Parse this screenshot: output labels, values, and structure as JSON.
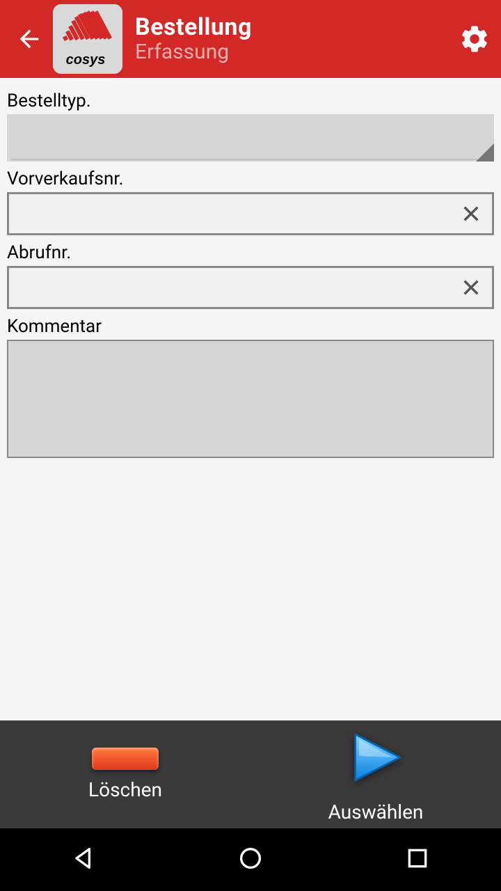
{
  "header": {
    "title": "Bestellung",
    "subtitle": "Erfassung",
    "logo_brand": "cosys"
  },
  "form": {
    "type_label": "Bestelltyp.",
    "type_value": "",
    "presale_label": "Vorverkaufsnr.",
    "presale_value": "",
    "callno_label": "Abrufnr.",
    "callno_value": "",
    "comment_label": "Kommentar",
    "comment_value": ""
  },
  "actions": {
    "delete_label": "Löschen",
    "select_label": "Auswählen"
  },
  "colors": {
    "primary": "#d22927",
    "action_accent": "#28a6ff"
  }
}
